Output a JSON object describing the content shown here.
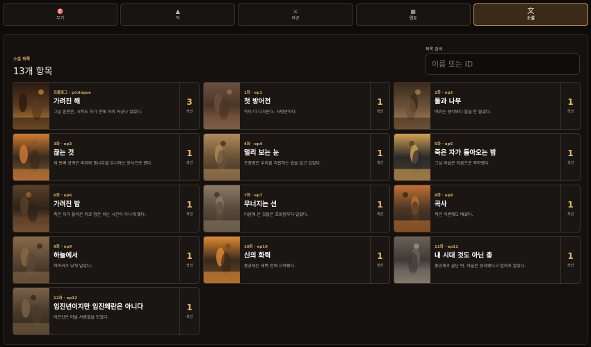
{
  "tabs": [
    {
      "icon": "🎯",
      "icon_name": "target-icon",
      "label": "무기",
      "active": false
    },
    {
      "icon": "▲",
      "icon_name": "helmet-icon",
      "label": "적",
      "active": false
    },
    {
      "icon": "⚔",
      "icon_name": "crossed-swords-icon",
      "label": "아군",
      "active": false
    },
    {
      "icon": "▦",
      "icon_name": "grid-icon",
      "label": "웹툰",
      "active": false
    },
    {
      "icon": "文",
      "icon_name": "text-icon",
      "label": "소설",
      "active": true
    }
  ],
  "list": {
    "section_label": "소설 목록",
    "count_title": "13개 항목"
  },
  "search": {
    "label": "목록 검색",
    "placeholder": "이름 또는 ID"
  },
  "colors": {
    "accent": "#d9a85c",
    "active_tab_bg": "#3a2a18",
    "active_tab_border": "#c99a58"
  },
  "episodes": [
    {
      "ep": "프롤로그 · prologue",
      "title": "가려진 해",
      "desc": "그날 훈련은, 시작도 하기 전에 이미 어긋나 있었다.",
      "count": "3",
      "unit": "섹션",
      "palette": [
        "#5a3a20",
        "#2a1a10",
        "#c98a40"
      ]
    },
    {
      "ep": "1화 · ep1",
      "title": "첫 방어전",
      "desc": "적이 더 다가온다. 사령관이다.",
      "count": "1",
      "unit": "섹션",
      "palette": [
        "#4a3426",
        "#6b5040",
        "#a07050"
      ]
    },
    {
      "ep": "2화 · ep2",
      "title": "돌과 나무",
      "desc": "바위는 생각보다 말을 안 들었다.",
      "count": "1",
      "unit": "섹션",
      "palette": [
        "#6a5038",
        "#3a2a1c",
        "#b08858"
      ]
    },
    {
      "ep": "3화 · ep3",
      "title": "끊는 것",
      "desc": "세 번째 공격은 바위와 통나무를 무시하는 방식으로 왔다.",
      "count": "1",
      "unit": "섹션",
      "palette": [
        "#3a2a1c",
        "#d07a30",
        "#7a5a3a"
      ]
    },
    {
      "ep": "4화 · ep4",
      "title": "멀리 보는 눈",
      "desc": "조총병은 우리를 괴롭히는 법을 알고 있었다.",
      "count": "1",
      "unit": "섹션",
      "palette": [
        "#6a5236",
        "#b08a5a",
        "#3a2c1e"
      ]
    },
    {
      "ep": "5화 · ep5",
      "title": "죽은 자가 돌아오는 밤",
      "desc": "그날 마을은 처음으로 축하했다.",
      "count": "1",
      "unit": "섹션",
      "palette": [
        "#2a2a2c",
        "#d0a050",
        "#4a3c30"
      ]
    },
    {
      "ep": "6화 · ep6",
      "title": "가려진 밤",
      "desc": "죽은 자가 돌아온 뒤로 밤은 쉬는 시간이 아니게 됐다.",
      "count": "1",
      "unit": "섹션",
      "palette": [
        "#2e2218",
        "#5a4028",
        "#a06a38"
      ]
    },
    {
      "ep": "7화 · ep7",
      "title": "무너지는 선",
      "desc": "다음에 온 것들은 포화림부터 달랐다.",
      "count": "1",
      "unit": "섹션",
      "palette": [
        "#5a4a3a",
        "#8a7a66",
        "#3a2e24"
      ]
    },
    {
      "ep": "8화 · ep8",
      "title": "곡사",
      "desc": "적은 이번에도 배웠다.",
      "count": "1",
      "unit": "섹션",
      "palette": [
        "#4a3828",
        "#c07030",
        "#2a1e14"
      ]
    },
    {
      "ep": "9화 · ep9",
      "title": "하늘에서",
      "desc": "까마귀가 낮게 날았다.",
      "count": "1",
      "unit": "섹션",
      "palette": [
        "#5a4836",
        "#8a6a48",
        "#2e2218"
      ]
    },
    {
      "ep": "10화 · ep10",
      "title": "신의 화력",
      "desc": "총공세는 새벽 전에 시작됐다.",
      "count": "1",
      "unit": "섹션",
      "palette": [
        "#3a2a1a",
        "#e08a30",
        "#6a4a2a"
      ]
    },
    {
      "ep": "11화 · ep11",
      "title": "내 시대 것도 아닌 총",
      "desc": "총공세가 끝난 뒤, 마을은 승리했다고 말하지 않았다.",
      "count": "1",
      "unit": "섹션",
      "palette": [
        "#3e3a38",
        "#6a6258",
        "#a89a88"
      ]
    },
    {
      "ep": "12화 · ep12",
      "title": "임진년이지만 임진왜란은 아니다",
      "desc": "어르신은 마을 사람들을 모았다.",
      "count": "1",
      "unit": "섹션",
      "palette": [
        "#4a3a2a",
        "#7a6248",
        "#2c2218"
      ]
    }
  ]
}
